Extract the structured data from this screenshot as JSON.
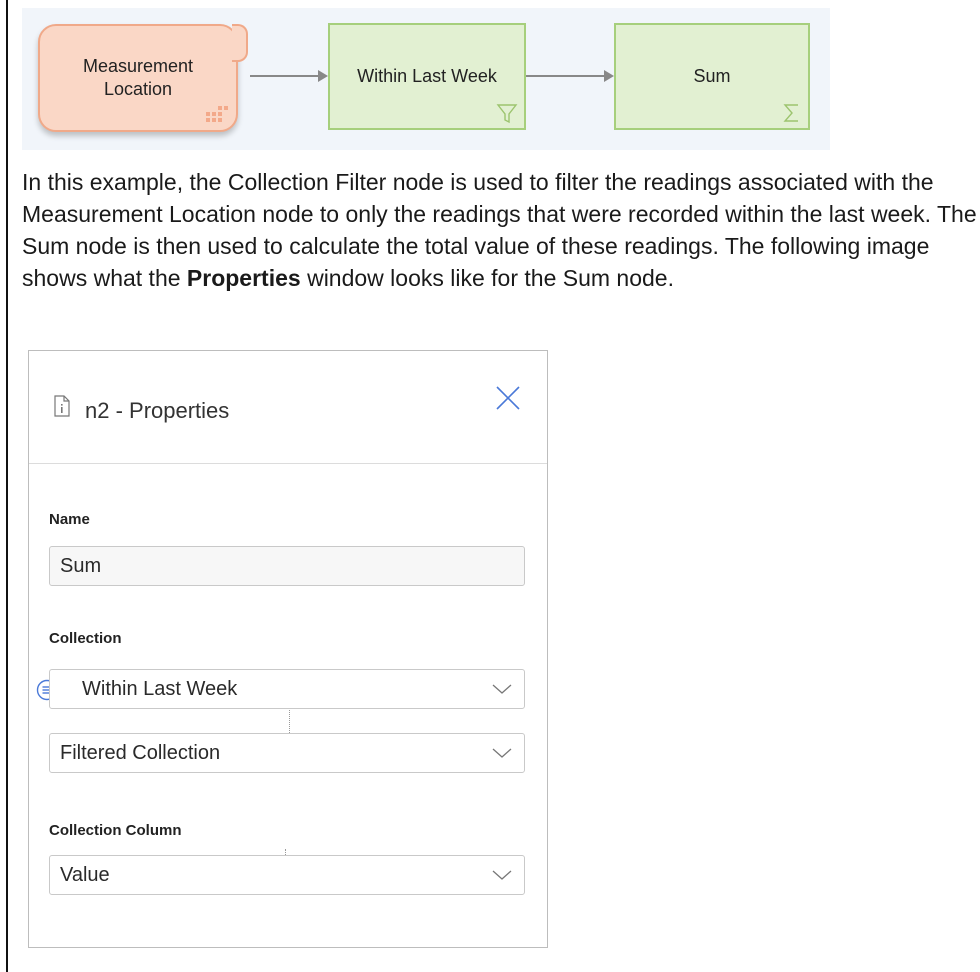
{
  "diagram": {
    "nodes": [
      {
        "label_line1": "Measurement",
        "label_line2": "Location",
        "icon": "scatter-dots-icon"
      },
      {
        "label": "Within Last Week",
        "icon": "filter-icon"
      },
      {
        "label": "Sum",
        "icon": "sigma-icon"
      }
    ],
    "colors": {
      "source_fill": "#fad7c6",
      "source_border": "#f0a989",
      "node_fill": "#e2f0d2",
      "node_border": "#a6cf7c",
      "arrow": "#888888"
    }
  },
  "paragraph": {
    "text_before": "In this example, the Collection Filter node is used to filter the readings associated with the Measurement Location node to only the readings that were recorded within the last week. The Sum node is then used to calculate the total value of these readings. The following image shows what the ",
    "bold": "Properties",
    "text_after": " window looks like for the Sum node."
  },
  "panel": {
    "title": "n2 - Properties",
    "info_icon": "info-document-icon",
    "close_icon": "close-icon",
    "name_label": "Name",
    "name_value": "Sum",
    "collection_label": "Collection",
    "collection_value": "Within Last Week",
    "collection_sub_value": "Filtered Collection",
    "column_label": "Collection Column",
    "column_value": "Value",
    "accent_color": "#4a79d8"
  }
}
